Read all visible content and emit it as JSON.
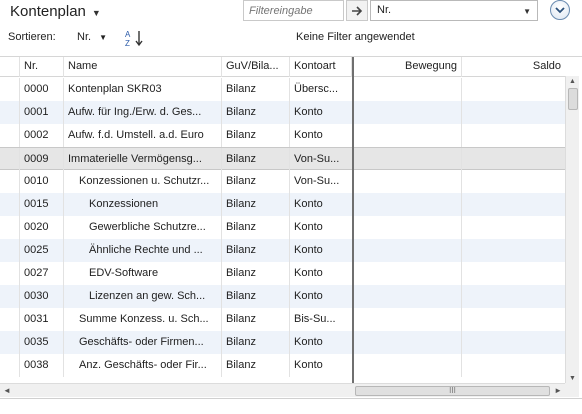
{
  "header": {
    "title": "Kontenplan",
    "filter_placeholder": "Filtereingabe",
    "filter_field": "Nr."
  },
  "sort": {
    "label": "Sortieren:",
    "field": "Nr.",
    "sort_icon_letters": "AZ",
    "filter_status": "Keine Filter angewendet"
  },
  "columns": [
    "Nr.",
    "Name",
    "GuV/Bila...",
    "Kontoart",
    "Bewegung",
    "Saldo"
  ],
  "rows": [
    {
      "nr": "0000",
      "name": "Kontenplan SKR03",
      "guv": "Bilanz",
      "kontoart": "Übersc...",
      "indent": 0
    },
    {
      "nr": "0001",
      "name": "Aufw. für Ing./Erw. d. Ges...",
      "guv": "Bilanz",
      "kontoart": "Konto",
      "indent": 0
    },
    {
      "nr": "0002",
      "name": "Aufw. f.d. Umstell. a.d. Euro",
      "guv": "Bilanz",
      "kontoart": "Konto",
      "indent": 0
    },
    {
      "nr": "0009",
      "name": "Immaterielle Vermögensg...",
      "guv": "Bilanz",
      "kontoart": "Von-Su...",
      "indent": 0
    },
    {
      "nr": "0010",
      "name": "Konzessionen u. Schutzr...",
      "guv": "Bilanz",
      "kontoart": "Von-Su...",
      "indent": 1
    },
    {
      "nr": "0015",
      "name": "Konzessionen",
      "guv": "Bilanz",
      "kontoart": "Konto",
      "indent": 2
    },
    {
      "nr": "0020",
      "name": "Gewerbliche Schutzre...",
      "guv": "Bilanz",
      "kontoart": "Konto",
      "indent": 2
    },
    {
      "nr": "0025",
      "name": "Ähnliche Rechte und ...",
      "guv": "Bilanz",
      "kontoart": "Konto",
      "indent": 2
    },
    {
      "nr": "0027",
      "name": "EDV-Software",
      "guv": "Bilanz",
      "kontoart": "Konto",
      "indent": 2
    },
    {
      "nr": "0030",
      "name": "Lizenzen an gew. Sch...",
      "guv": "Bilanz",
      "kontoart": "Konto",
      "indent": 2
    },
    {
      "nr": "0031",
      "name": "Summe Konzess. u. Sch...",
      "guv": "Bilanz",
      "kontoart": "Bis-Su...",
      "indent": 1
    },
    {
      "nr": "0035",
      "name": "Geschäfts- oder Firmen...",
      "guv": "Bilanz",
      "kontoart": "Konto",
      "indent": 1
    },
    {
      "nr": "0038",
      "name": "Anz. Geschäfts- oder Fir...",
      "guv": "Bilanz",
      "kontoart": "Konto",
      "indent": 1
    }
  ],
  "selected_row_index": 3,
  "scrollbar": {
    "h_thumb_glyph": "III"
  }
}
